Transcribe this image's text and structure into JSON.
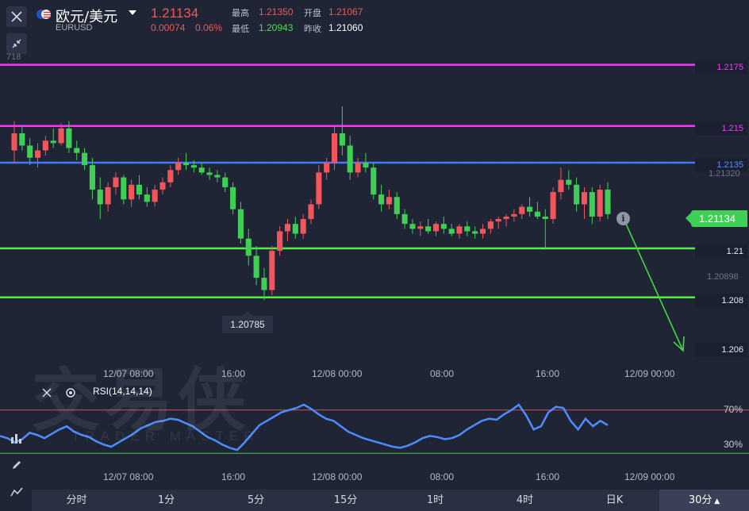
{
  "header": {
    "pair_name": "欧元/美元",
    "pair_code": "EURUSD",
    "price": "1.21134",
    "change": "0.00074",
    "change_pct": "0.06%",
    "high_label": "最高",
    "high": "1.21350",
    "open_label": "开盘",
    "open": "1.21067",
    "low_label": "最低",
    "low": "1.20943",
    "prev_close_label": "昨收",
    "prev_close": "1.21060"
  },
  "axis_cut_label": "718",
  "levels": [
    {
      "label": "1.2175",
      "price": 1.2175,
      "color": "#ff33ff"
    },
    {
      "label": "1.215",
      "price": 1.215,
      "color": "#ff33ff"
    },
    {
      "label": "1.2135",
      "price": 1.2135,
      "color": "#3f7bff"
    },
    {
      "label": "1.21",
      "price": 1.21,
      "color": "#55ee44"
    },
    {
      "label": "1.208",
      "price": 1.208,
      "color": "#55ee44"
    }
  ],
  "arrow_target_label": "1.206",
  "axis_ticks": [
    "1.21320",
    "1.20898"
  ],
  "current_price_label": "1.21134",
  "low_marker": "1.20785",
  "time_labels_main": [
    "12/07 08:00",
    "16:00",
    "12/08 00:00",
    "08:00",
    "16:00",
    "12/09 00:00"
  ],
  "time_labels_rsi": [
    "12/07 08:00",
    "16:00",
    "12/08 00:00",
    "08:00",
    "16:00",
    "12/09 00:00"
  ],
  "rsi": {
    "title": "RSI(14,14,14)",
    "upper_label": "70%",
    "lower_label": "30%",
    "upper": 70,
    "lower": 30
  },
  "watermark": {
    "main": "交易侠",
    "sub": "TRADER MASTER"
  },
  "tabs": [
    {
      "label": "分时"
    },
    {
      "label": "1分"
    },
    {
      "label": "5分"
    },
    {
      "label": "15分"
    },
    {
      "label": "1时"
    },
    {
      "label": "4时"
    },
    {
      "label": "日K"
    },
    {
      "label": "30分",
      "active": true
    }
  ],
  "colors": {
    "up": "#f0565b",
    "down": "#3fcf55",
    "bg": "#1f2535",
    "rsi_line": "#4f8cff"
  },
  "chart_data": {
    "type": "candlestick",
    "symbol": "EURUSD",
    "interval": "30m",
    "ylim": [
      1.2054,
      1.2182
    ],
    "candles": [
      [
        1.214,
        1.2152,
        1.2135,
        1.2147
      ],
      [
        1.2147,
        1.215,
        1.214,
        1.2142
      ],
      [
        1.2142,
        1.2145,
        1.2134,
        1.2137
      ],
      [
        1.2137,
        1.2143,
        1.2133,
        1.214
      ],
      [
        1.214,
        1.2146,
        1.2138,
        1.2144
      ],
      [
        1.2144,
        1.2149,
        1.2141,
        1.2143
      ],
      [
        1.2143,
        1.2151,
        1.2142,
        1.2149
      ],
      [
        1.2149,
        1.2152,
        1.2139,
        1.2141
      ],
      [
        1.2141,
        1.2144,
        1.2136,
        1.2139
      ],
      [
        1.2139,
        1.2141,
        1.2132,
        1.2134
      ],
      [
        1.2134,
        1.2137,
        1.212,
        1.2124
      ],
      [
        1.2124,
        1.2129,
        1.2112,
        1.2118
      ],
      [
        1.2118,
        1.2127,
        1.2115,
        1.2125
      ],
      [
        1.2125,
        1.2131,
        1.2122,
        1.2129
      ],
      [
        1.2129,
        1.213,
        1.2118,
        1.212
      ],
      [
        1.212,
        1.2128,
        1.2117,
        1.2126
      ],
      [
        1.2126,
        1.213,
        1.212,
        1.2122
      ],
      [
        1.2122,
        1.2125,
        1.2117,
        1.2119
      ],
      [
        1.2119,
        1.2126,
        1.2117,
        1.2124
      ],
      [
        1.2124,
        1.2129,
        1.2122,
        1.2127
      ],
      [
        1.2127,
        1.2134,
        1.2125,
        1.2132
      ],
      [
        1.2132,
        1.2137,
        1.213,
        1.2135
      ],
      [
        1.2135,
        1.2139,
        1.2132,
        1.2134
      ],
      [
        1.2134,
        1.2136,
        1.2131,
        1.2133
      ],
      [
        1.2133,
        1.2135,
        1.213,
        1.2131
      ],
      [
        1.2131,
        1.2133,
        1.2128,
        1.213
      ],
      [
        1.213,
        1.2132,
        1.2127,
        1.2129
      ],
      [
        1.2129,
        1.2131,
        1.2123,
        1.2125
      ],
      [
        1.2125,
        1.2127,
        1.2114,
        1.2116
      ],
      [
        1.2116,
        1.2119,
        1.2102,
        1.2104
      ],
      [
        1.2104,
        1.2108,
        1.2093,
        1.2097
      ],
      [
        1.2097,
        1.2101,
        1.2085,
        1.2088
      ],
      [
        1.2088,
        1.2092,
        1.2079,
        1.2083
      ],
      [
        1.2083,
        1.2101,
        1.2081,
        1.2099
      ],
      [
        1.2099,
        1.2109,
        1.2097,
        1.2107
      ],
      [
        1.2107,
        1.2112,
        1.2103,
        1.211
      ],
      [
        1.211,
        1.2113,
        1.2104,
        1.2106
      ],
      [
        1.2106,
        1.2114,
        1.2104,
        1.2112
      ],
      [
        1.2112,
        1.212,
        1.211,
        1.2118
      ],
      [
        1.2118,
        1.2134,
        1.2116,
        1.2131
      ],
      [
        1.2131,
        1.2137,
        1.2128,
        1.2135
      ],
      [
        1.2135,
        1.215,
        1.2132,
        1.2147
      ],
      [
        1.2147,
        1.2158,
        1.2138,
        1.2142
      ],
      [
        1.2142,
        1.2146,
        1.2128,
        1.2131
      ],
      [
        1.2131,
        1.2137,
        1.2129,
        1.2135
      ],
      [
        1.2135,
        1.2139,
        1.2131,
        1.2133
      ],
      [
        1.2133,
        1.2135,
        1.212,
        1.2122
      ],
      [
        1.2122,
        1.2126,
        1.2115,
        1.2118
      ],
      [
        1.2118,
        1.2124,
        1.2116,
        1.2121
      ],
      [
        1.2121,
        1.2123,
        1.2112,
        1.2114
      ],
      [
        1.2114,
        1.2116,
        1.2108,
        1.211
      ],
      [
        1.211,
        1.2112,
        1.2106,
        1.2108
      ],
      [
        1.2108,
        1.2111,
        1.2105,
        1.2109
      ],
      [
        1.2109,
        1.2112,
        1.2106,
        1.2107
      ],
      [
        1.2107,
        1.2111,
        1.2105,
        1.211
      ],
      [
        1.211,
        1.2113,
        1.2106,
        1.2108
      ],
      [
        1.2108,
        1.211,
        1.2105,
        1.2106
      ],
      [
        1.2106,
        1.211,
        1.2104,
        1.2109
      ],
      [
        1.2109,
        1.2111,
        1.2105,
        1.2107
      ],
      [
        1.2107,
        1.2109,
        1.2104,
        1.2106
      ],
      [
        1.2106,
        1.211,
        1.2104,
        1.2108
      ],
      [
        1.2108,
        1.2112,
        1.2106,
        1.2111
      ],
      [
        1.2111,
        1.2113,
        1.2108,
        1.2112
      ],
      [
        1.2112,
        1.2114,
        1.2109,
        1.2113
      ],
      [
        1.2113,
        1.2116,
        1.2111,
        1.2114
      ],
      [
        1.2114,
        1.2118,
        1.2112,
        1.2117
      ],
      [
        1.2117,
        1.2121,
        1.2113,
        1.2115
      ],
      [
        1.2115,
        1.2119,
        1.2112,
        1.2113
      ],
      [
        1.2113,
        1.2116,
        1.21,
        1.2112
      ],
      [
        1.2112,
        1.2125,
        1.211,
        1.2123
      ],
      [
        1.2123,
        1.2133,
        1.212,
        1.2128
      ],
      [
        1.2128,
        1.2132,
        1.2124,
        1.2126
      ],
      [
        1.2126,
        1.2129,
        1.2115,
        1.2118
      ],
      [
        1.2118,
        1.2125,
        1.2112,
        1.2123
      ],
      [
        1.2123,
        1.2125,
        1.211,
        1.2113
      ],
      [
        1.2113,
        1.2126,
        1.2111,
        1.2124
      ],
      [
        1.2124,
        1.2127,
        1.2112,
        1.2114
      ]
    ],
    "rsi_series": [
      46,
      44,
      40,
      43,
      49,
      47,
      44,
      48,
      52,
      55,
      50,
      47,
      45,
      41,
      38,
      36,
      40,
      44,
      48,
      53,
      56,
      59,
      60,
      62,
      61,
      58,
      55,
      50,
      45,
      42,
      38,
      35,
      33,
      40,
      48,
      56,
      60,
      64,
      68,
      70,
      72,
      75,
      71,
      66,
      62,
      60,
      55,
      50,
      47,
      44,
      42,
      40,
      38,
      36,
      35,
      37,
      40,
      44,
      46,
      45,
      43,
      44,
      47,
      52,
      56,
      60,
      62,
      61,
      66,
      70,
      75,
      65,
      52,
      55,
      68,
      73,
      72,
      60,
      52,
      62,
      55,
      60,
      56
    ]
  }
}
